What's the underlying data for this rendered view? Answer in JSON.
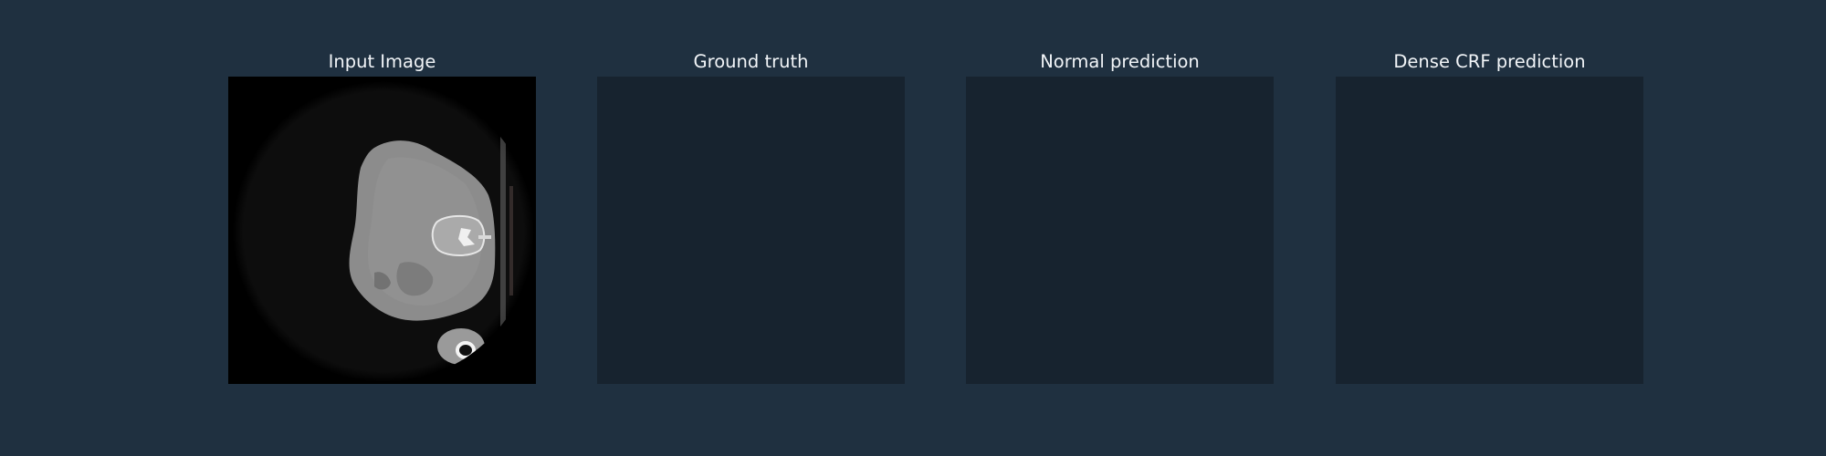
{
  "panels": [
    {
      "title": "Input Image"
    },
    {
      "title": "Ground truth"
    },
    {
      "title": "Normal prediction"
    },
    {
      "title": "Dense CRF prediction"
    }
  ],
  "colors": {
    "background": "#1f3040",
    "empty_mask": "#17232f",
    "title_text": "#f2f5f8"
  }
}
